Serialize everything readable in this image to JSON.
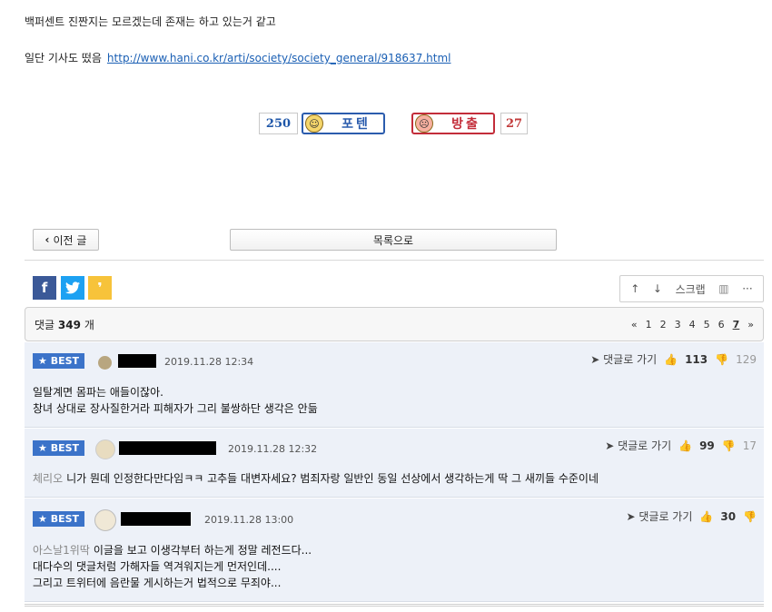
{
  "post": {
    "line1": "백퍼센트 진짠지는 모르겠는데 존재는 하고 있는거 같고",
    "line2_prefix": "일단 기사도 떴음",
    "link_text": "http://www.hani.co.kr/arti/society/society_general/918637.html"
  },
  "vote": {
    "up_count": "250",
    "up_label": "포텐",
    "down_label": "방출",
    "down_count": "27"
  },
  "nav": {
    "prev_label": "이전 글",
    "list_label": "목록으로"
  },
  "tools": {
    "scrap_label": "스크랩"
  },
  "comments_header": {
    "label": "댓글",
    "count": "349",
    "unit": "개",
    "pages": [
      "1",
      "2",
      "3",
      "4",
      "5",
      "6",
      "7"
    ],
    "current_page": "7"
  },
  "comments": [
    {
      "badge": "BEST",
      "date": "2019.11.28 12:34",
      "reply_label": "댓글로 가기",
      "up": "113",
      "down": "129",
      "nick": "",
      "lines": [
        "일탈계면 몸파는 애들이잖아.",
        "창녀 상대로 장사질한거라 피해자가 그리 불쌍하단 생각은 안듦"
      ]
    },
    {
      "badge": "BEST",
      "date": "2019.11.28 12:32",
      "reply_label": "댓글로 가기",
      "up": "99",
      "down": "17",
      "nick": "체리오",
      "lines": [
        "니가 뭔데 인정한다만다임ㅋㅋ 고추들 대변자세요? 범죄자랑 일반인 동일 선상에서 생각하는게 딱 그 새끼들 수준이네"
      ]
    },
    {
      "badge": "BEST",
      "date": "2019.11.28 13:00",
      "reply_label": "댓글로 가기",
      "up": "30",
      "down": "",
      "nick": "아스날1위딱",
      "lines": [
        "이글을 보고 이생각부터 하는게 정말 레전드다...",
        "대다수의 댓글처럼 가해자들 역겨워지는게 먼저인데....",
        "그리고 트위터에 음란물 게시하는거 법적으로 무죄야..."
      ]
    }
  ]
}
